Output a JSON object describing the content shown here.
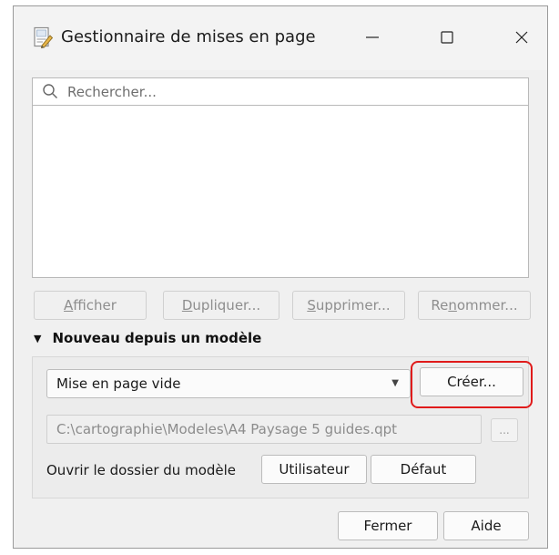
{
  "window": {
    "title": "Gestionnaire de mises en page",
    "minimize_glyph": "—",
    "maximize_glyph": "☐",
    "close_glyph": "✕"
  },
  "search": {
    "placeholder": "Rechercher..."
  },
  "layout_buttons": {
    "show": {
      "pre": "",
      "ul": "A",
      "post": "fficher"
    },
    "duplicate": {
      "pre": "",
      "ul": "D",
      "post": "upliquer..."
    },
    "delete": {
      "pre": "",
      "ul": "S",
      "post": "upprimer..."
    },
    "rename": {
      "pre": "Re",
      "ul": "n",
      "post": "ommer..."
    }
  },
  "template_group": {
    "title": "Nouveau depuis un modèle",
    "selected_template": "Mise en page vide",
    "create_label": "Créer...",
    "template_path": "C:\\cartographie\\Modeles\\A4 Paysage 5 guides.qpt",
    "browse_label": "...",
    "open_folder_label": "Ouvrir le dossier du modèle",
    "user_label": "Utilisateur",
    "default_label": "Défaut"
  },
  "footer": {
    "close_label": "Fermer",
    "help_label": "Aide"
  },
  "colors": {
    "highlight": "#e01b1b",
    "window_bg": "#f0f0f0"
  },
  "icons": [
    "layout-manager-icon",
    "search-icon"
  ]
}
